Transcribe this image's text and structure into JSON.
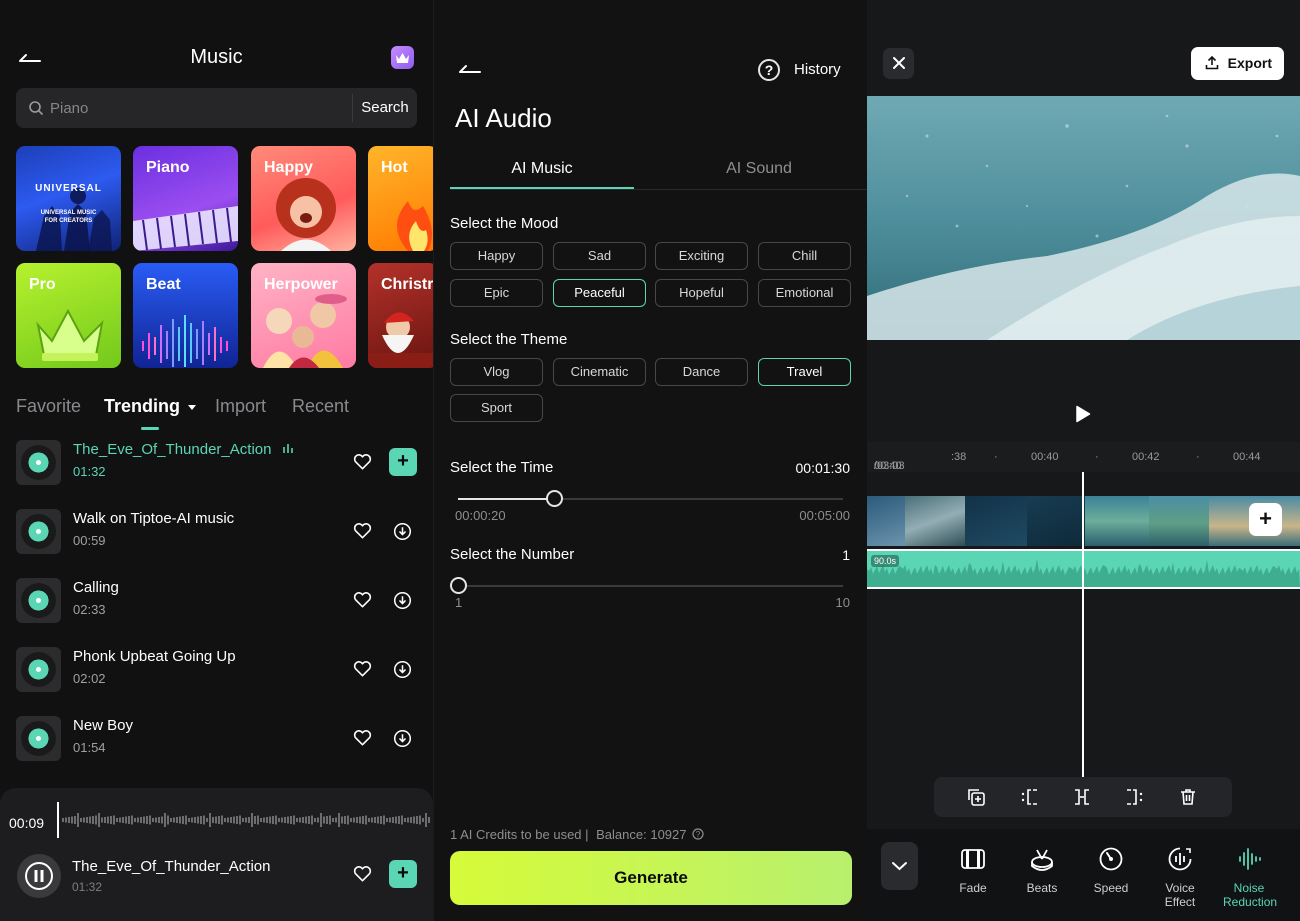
{
  "music": {
    "title": "Music",
    "search": {
      "placeholder": "Piano",
      "button": "Search"
    },
    "tiles": [
      {
        "label": "UNIVERSAL",
        "sublabel": "UNIVERSAL MUSIC FOR CREATORS"
      },
      {
        "label": "Piano"
      },
      {
        "label": "Happy"
      },
      {
        "label": "Hot"
      },
      {
        "label": "Pro"
      },
      {
        "label": "Beat"
      },
      {
        "label": "Herpower"
      },
      {
        "label": "Christr"
      }
    ],
    "tabs": [
      "Favorite",
      "Trending",
      "Import",
      "Recent"
    ],
    "active_tab": "Trending",
    "songs": [
      {
        "name": "The_Eve_Of_Thunder_Action",
        "duration": "01:32",
        "playing": true
      },
      {
        "name": "Walk on Tiptoe-AI music",
        "duration": "00:59"
      },
      {
        "name": "Calling",
        "duration": "02:33"
      },
      {
        "name": "Phonk Upbeat Going Up",
        "duration": "02:02"
      },
      {
        "name": "New Boy",
        "duration": "01:54"
      }
    ],
    "player": {
      "time": "00:09",
      "name": "The_Eve_Of_Thunder_Action",
      "duration": "01:32",
      "progress": 0.01
    }
  },
  "ai": {
    "history": "History",
    "title": "AI Audio",
    "tabs": [
      "AI Music",
      "AI Sound"
    ],
    "mood_label": "Select the Mood",
    "moods": [
      "Happy",
      "Sad",
      "Exciting",
      "Chill",
      "Epic",
      "Peaceful",
      "Hopeful",
      "Emotional"
    ],
    "mood_selected": "Peaceful",
    "theme_label": "Select the Theme",
    "themes": [
      "Vlog",
      "Cinematic",
      "Dance",
      "Travel",
      "Sport"
    ],
    "theme_selected": "Travel",
    "time_label": "Select the Time",
    "time_value": "00:01:30",
    "time_min": "00:00:20",
    "time_max": "00:05:00",
    "time_fraction": 0.25,
    "number_label": "Select the Number",
    "number_value": "1",
    "number_min": "1",
    "number_max": "10",
    "credits": "1 AI Credits to be used |",
    "balance": "Balance: 10927",
    "generate": "Generate"
  },
  "editor": {
    "export": "Export",
    "ruler": {
      "current": "00:40",
      "total": "/03:03",
      "marks": [
        ":38",
        "00:40",
        "00:42",
        "00:44"
      ]
    },
    "audio_tag": "90.0s",
    "tools": [
      {
        "label": "Fade",
        "icon": "fade-icon"
      },
      {
        "label": "Beats",
        "icon": "beats-icon"
      },
      {
        "label": "Speed",
        "icon": "speed-icon"
      },
      {
        "label": "Voice Effect",
        "icon": "voice-effect-icon"
      },
      {
        "label": "Noise Reduction",
        "icon": "noise-reduction-icon",
        "active": true
      }
    ],
    "colors": {
      "accent": "#5ad6b5",
      "generate": "#d6fb39"
    }
  }
}
